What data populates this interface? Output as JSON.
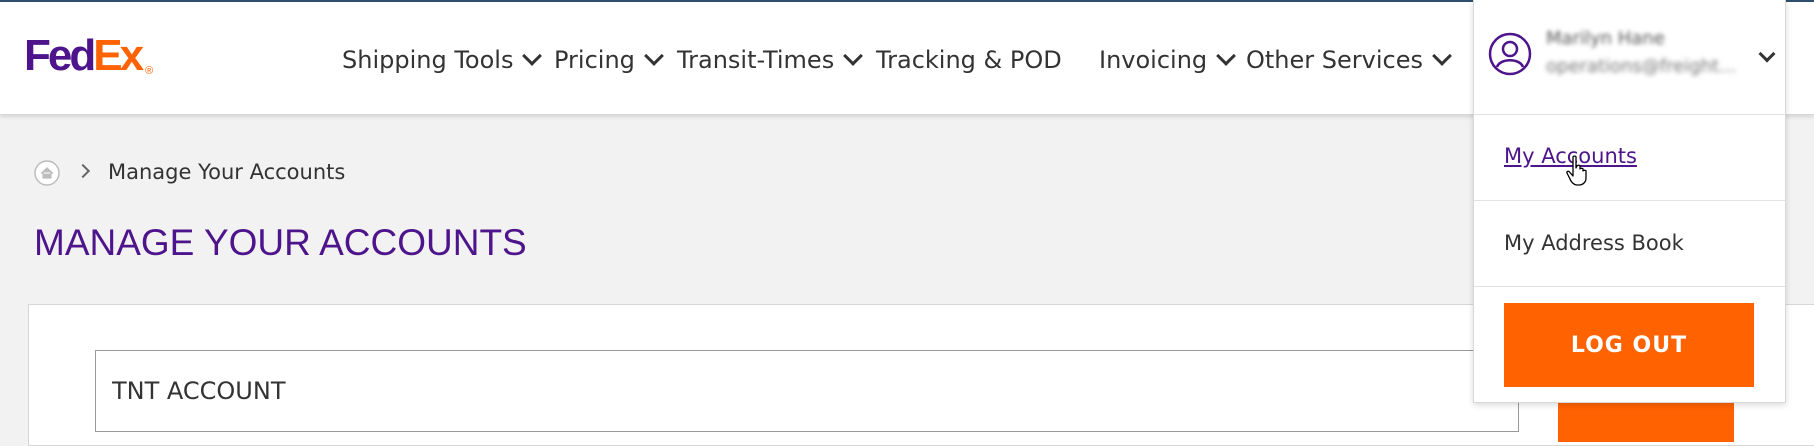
{
  "brand": {
    "logo_fed": "Fed",
    "logo_ex": "Ex",
    "logo_reg": "®",
    "purple": "#4d148c",
    "orange": "#ff6200"
  },
  "nav": {
    "items": [
      {
        "label": "Shipping Tools",
        "has_dropdown": true
      },
      {
        "label": "Pricing",
        "has_dropdown": true
      },
      {
        "label": "Transit-Times",
        "has_dropdown": true
      },
      {
        "label": "Tracking & POD",
        "has_dropdown": false
      },
      {
        "label": "Invoicing",
        "has_dropdown": true
      },
      {
        "label": "Other Services",
        "has_dropdown": true
      }
    ]
  },
  "account_menu": {
    "user_name": "Marilyn Hane",
    "user_email": "operations@freight...",
    "expanded": true,
    "items": [
      {
        "label": "My Accounts",
        "hovered": true
      },
      {
        "label": "My Address Book",
        "hovered": false
      }
    ],
    "logout_label": "LOG OUT"
  },
  "breadcrumb": {
    "current": "Manage Your Accounts"
  },
  "page": {
    "title": "MANAGE YOUR ACCOUNTS",
    "account_field_value": "TNT ACCOUNT"
  },
  "icons": {
    "home": "home-icon",
    "user": "user-avatar-icon",
    "chevron": "chevron-down-icon",
    "cursor": "hand-cursor-icon"
  }
}
